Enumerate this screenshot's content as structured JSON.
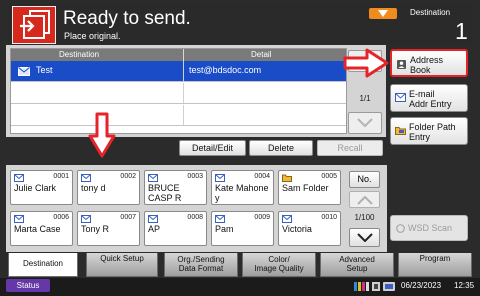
{
  "header": {
    "title": "Ready to send.",
    "subtitle": "Place original.",
    "destination_label": "Destination",
    "destination_count": "1"
  },
  "dest_table": {
    "col_destination": "Destination",
    "col_detail": "Detail",
    "rows": [
      {
        "name": "Test",
        "detail": "test@bdsdoc.com",
        "selected": true
      },
      {
        "name": "",
        "detail": "",
        "selected": false
      },
      {
        "name": "",
        "detail": "",
        "selected": false
      }
    ],
    "page": "1/1"
  },
  "side_buttons": {
    "address_book": [
      "Address",
      "Book"
    ],
    "email": [
      "E-mail",
      "Addr Entry"
    ],
    "folder": [
      "Folder Path",
      "Entry"
    ]
  },
  "actions": {
    "detail_edit": "Detail/Edit",
    "delete": "Delete",
    "recall": "Recall"
  },
  "one_touch_keys": [
    {
      "num": "0001",
      "name": "Julie Clark",
      "icon": "mail-icon"
    },
    {
      "num": "0002",
      "name": "tony d",
      "icon": "mail-icon"
    },
    {
      "num": "0003",
      "name": "BRUCE CASP R",
      "icon": "mail-icon"
    },
    {
      "num": "0004",
      "name": "Kate Mahone y",
      "icon": "mail-icon"
    },
    {
      "num": "0005",
      "name": "Sam Folder",
      "icon": "folder-icon"
    },
    {
      "num": "0006",
      "name": "Marta Case",
      "icon": "mail-icon"
    },
    {
      "num": "0007",
      "name": "Tony R",
      "icon": "mail-icon"
    },
    {
      "num": "0008",
      "name": "AP",
      "icon": "mail-icon"
    },
    {
      "num": "0009",
      "name": "Pam",
      "icon": "mail-icon"
    },
    {
      "num": "0010",
      "name": "Victoria",
      "icon": "mail-icon"
    }
  ],
  "keys_nav": {
    "no_label": "No.",
    "page": "1/100"
  },
  "wsd_scan": "WSD Scan",
  "tabs": [
    {
      "line1": "Destination",
      "line2": "",
      "active": true
    },
    {
      "line1": "Quick Setup",
      "line2": "",
      "active": false
    },
    {
      "line1": "Org./Sending",
      "line2": "Data Format",
      "active": false
    },
    {
      "line1": "Color/",
      "line2": "Image Quality",
      "active": false
    },
    {
      "line1": "Advanced",
      "line2": "Setup",
      "active": false
    },
    {
      "line1": "Program",
      "line2": "",
      "active": false
    }
  ],
  "status_bar": {
    "status_label": "Status",
    "date": "06/23/2023",
    "time": "12:35"
  },
  "colors": {
    "accent_red": "#d7281e",
    "selected_blue": "#1a4cc8",
    "status_purple": "#6438a8",
    "toggle_orange": "#f08c1e"
  }
}
